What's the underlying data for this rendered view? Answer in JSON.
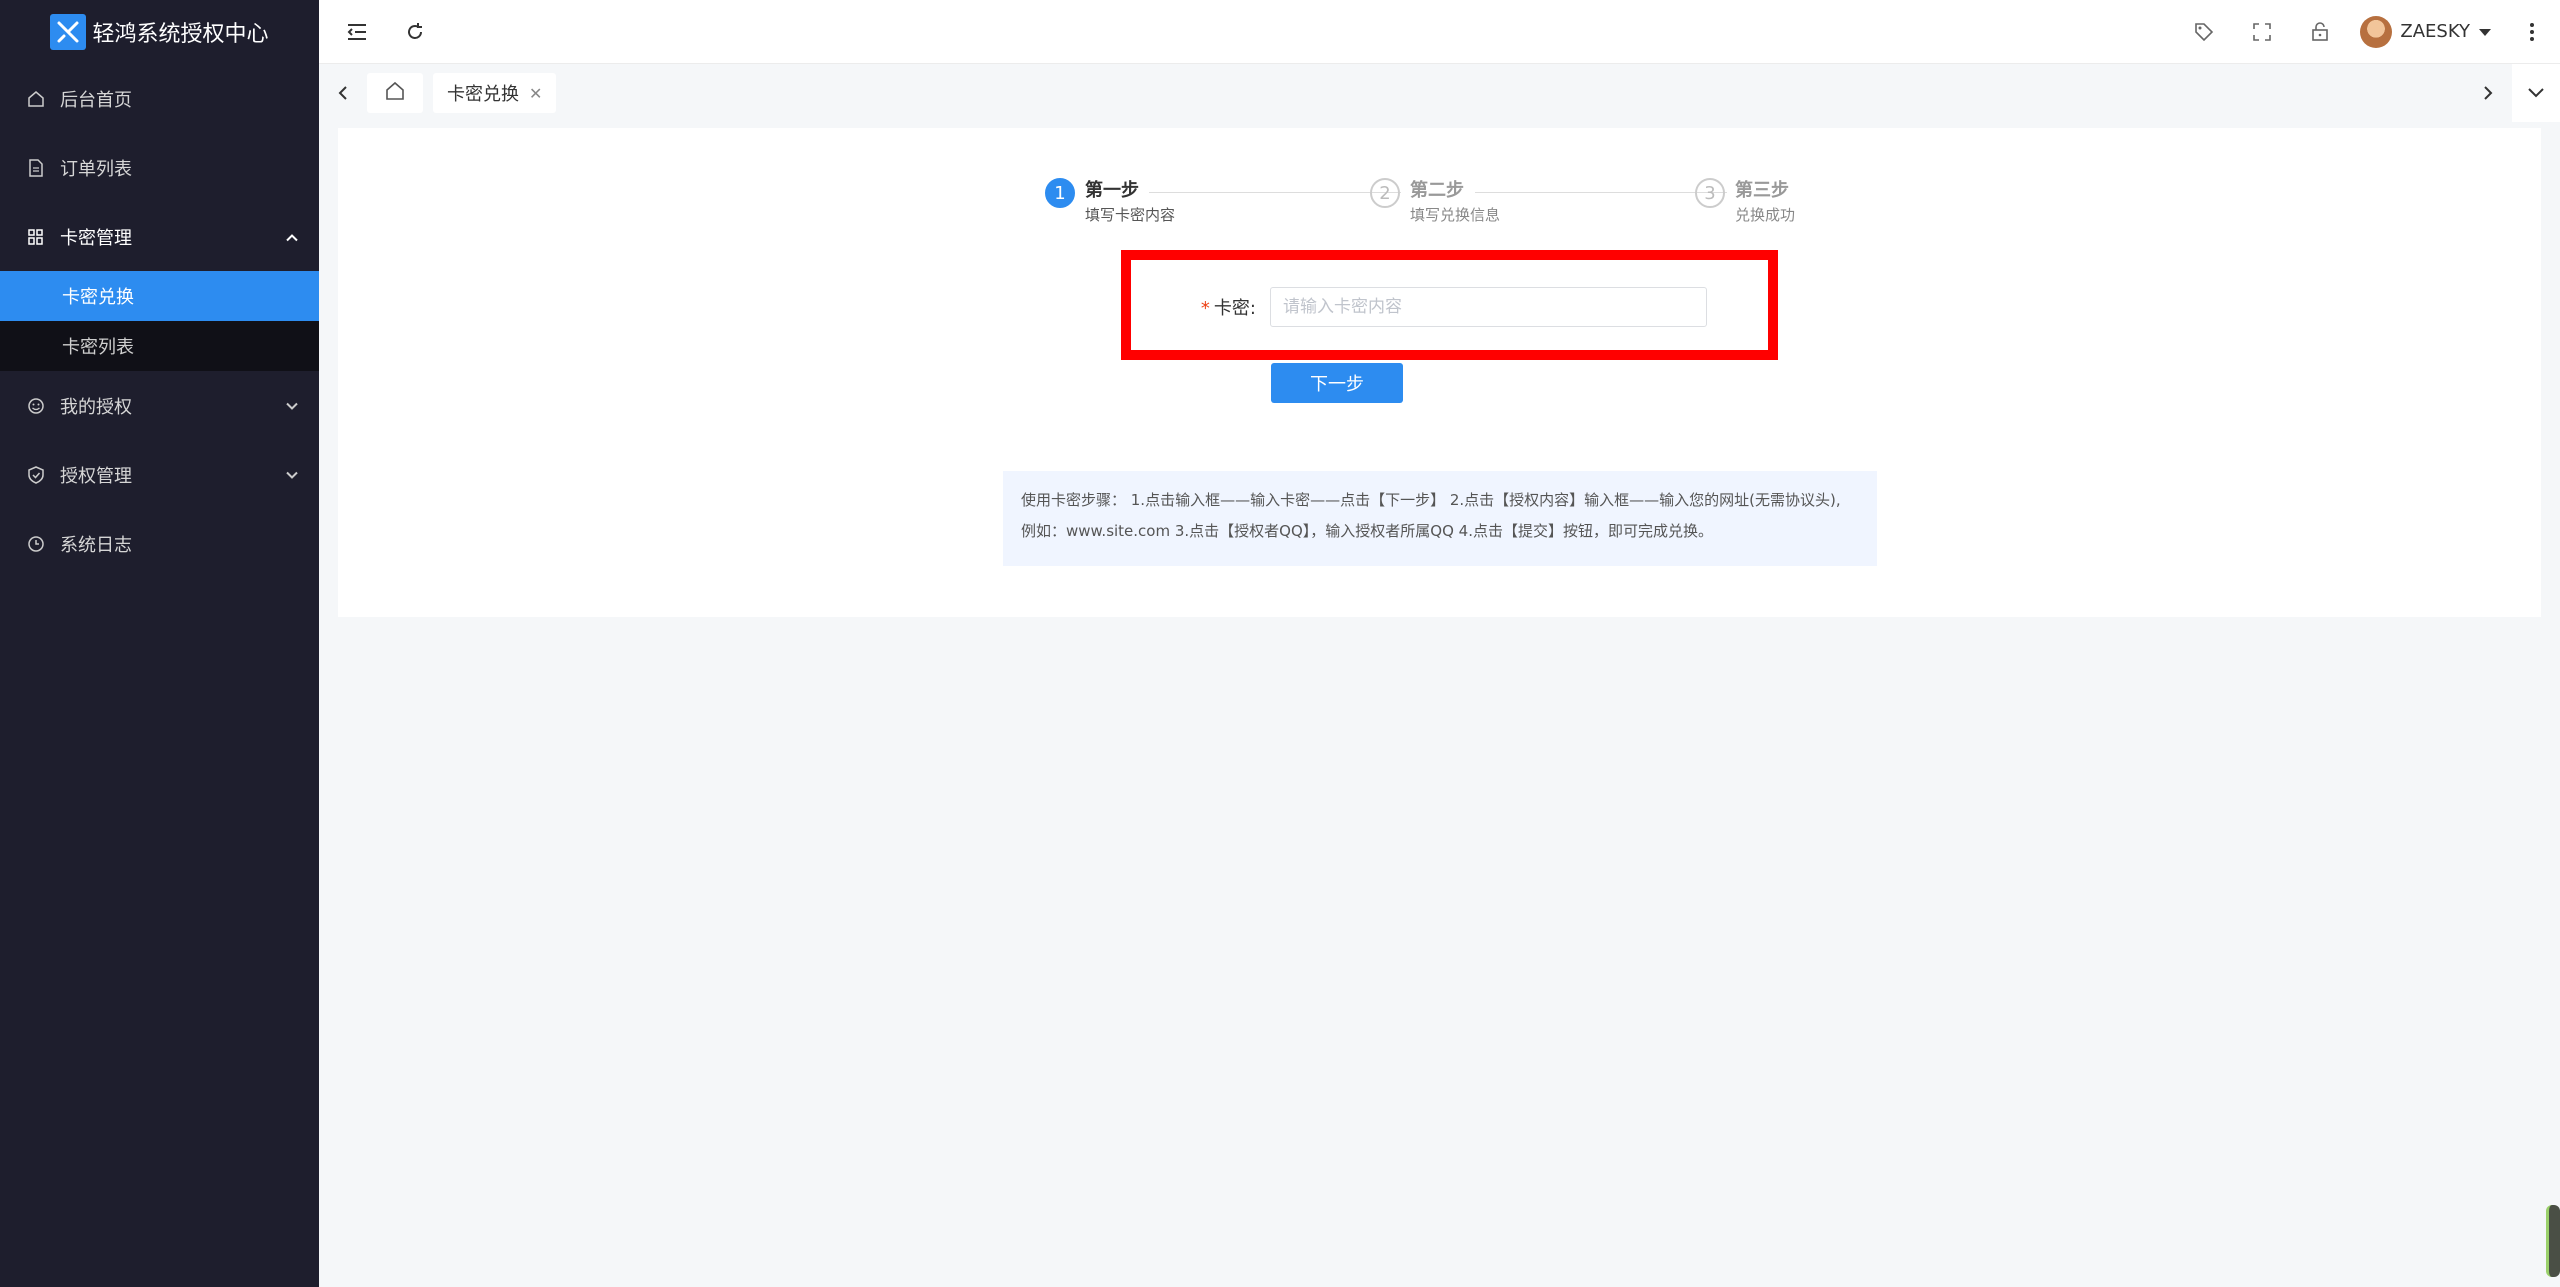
{
  "app": {
    "title": "轻鸿系统授权中心"
  },
  "sidebar": {
    "items": [
      {
        "label": "后台首页",
        "icon": "home-icon"
      },
      {
        "label": "订单列表",
        "icon": "document-icon"
      },
      {
        "label": "卡密管理",
        "icon": "grid-icon",
        "expanded": true,
        "children": [
          {
            "label": "卡密兑换",
            "active": true
          },
          {
            "label": "卡密列表",
            "active": false
          }
        ]
      },
      {
        "label": "我的授权",
        "icon": "smile-icon"
      },
      {
        "label": "授权管理",
        "icon": "shield-icon"
      },
      {
        "label": "系统日志",
        "icon": "clock-icon"
      }
    ]
  },
  "topbar": {
    "user_name": "ZAESKY"
  },
  "tabs": {
    "active_label": "卡密兑换"
  },
  "steps": [
    {
      "number": "1",
      "title": "第一步",
      "desc": "填写卡密内容",
      "active": true
    },
    {
      "number": "2",
      "title": "第二步",
      "desc": "填写兑换信息",
      "active": false
    },
    {
      "number": "3",
      "title": "第三步",
      "desc": "兑换成功",
      "active": false
    }
  ],
  "form": {
    "required_mark": "*",
    "label": "卡密:",
    "placeholder": "请输入卡密内容",
    "value": "",
    "next_button": "下一步"
  },
  "help": {
    "line1": "使用卡密步骤：  1.点击输入框——输入卡密——点击【下一步】 2.点击【授权内容】输入框——输入您的网址(无需协议头),",
    "line2": "例如：www.site.com 3.点击【授权者QQ】，输入授权者所属QQ 4.点击【提交】按钮，即可完成兑换。"
  },
  "colors": {
    "accent": "#2d8cf0",
    "sidebar_bg": "#1e1e2d",
    "highlight": "#ff0000"
  }
}
